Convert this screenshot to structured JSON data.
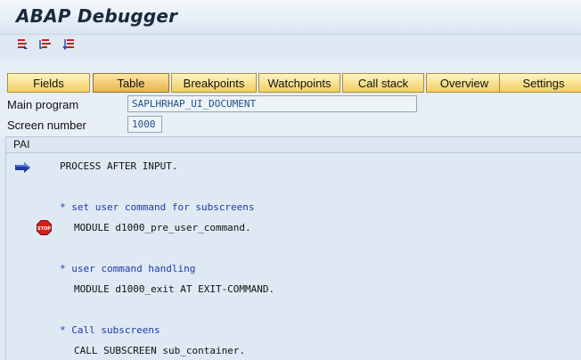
{
  "window": {
    "title": "ABAP Debugger"
  },
  "toolbar": {
    "icons": [
      "step-into-icon",
      "execute-icon",
      "return-icon"
    ]
  },
  "tabs": [
    {
      "label": "Fields",
      "active": false
    },
    {
      "label": "Table",
      "active": true
    },
    {
      "label": "Breakpoints",
      "active": false
    },
    {
      "label": "Watchpoints",
      "active": false
    },
    {
      "label": "Call stack",
      "active": false
    },
    {
      "label": "Overview",
      "active": false
    },
    {
      "label": "Settings",
      "active": false
    }
  ],
  "fields": {
    "main_program": {
      "label": "Main program",
      "value": "SAPLHRHAP_UI_DOCUMENT"
    },
    "screen_number": {
      "label": "Screen number",
      "value": "1000"
    }
  },
  "panel": {
    "label": "PAI"
  },
  "code": [
    {
      "text": "PROCESS AFTER INPUT.",
      "kind": "statement",
      "marker": "current-line-arrow"
    },
    {
      "text": "* set user command for subscreens",
      "kind": "comment"
    },
    {
      "text": "MODULE d1000_pre_user_command.",
      "kind": "statement",
      "marker": "breakpoint"
    },
    {
      "text": "* user command handling",
      "kind": "comment"
    },
    {
      "text": "MODULE d1000_exit AT EXIT-COMMAND.",
      "kind": "statement"
    },
    {
      "text": "* Call subscreens",
      "kind": "comment"
    },
    {
      "text": "CALL SUBSCREEN sub_container.",
      "kind": "statement"
    }
  ],
  "breakpoint_label": "STOP",
  "colors": {
    "tab_gradient_top": "#fff4c2",
    "tab_gradient_bottom": "#f1cf63",
    "comment": "#1f3aa8",
    "field_value": "#1c4f86",
    "background": "#dfe9f4"
  }
}
